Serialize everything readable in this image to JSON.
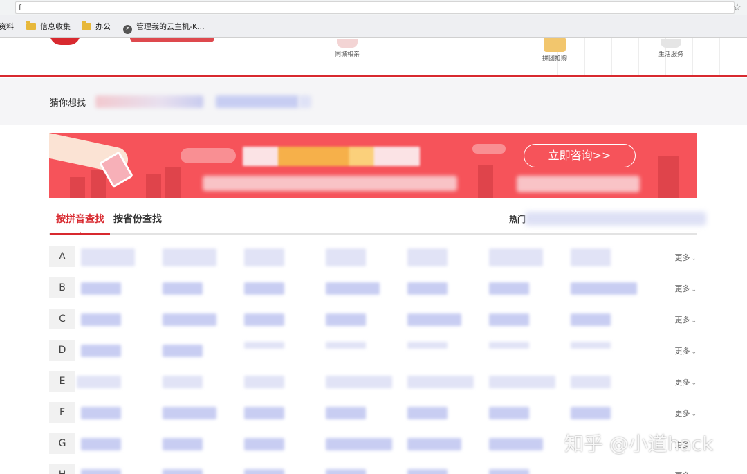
{
  "browser": {
    "address": "f",
    "bookmarks": [
      {
        "label": "资料",
        "icon": "none"
      },
      {
        "label": "信息收集",
        "icon": "folder-icon"
      },
      {
        "label": "办公",
        "icon": "folder-icon"
      },
      {
        "label": "管理我的云主机-K...",
        "icon": "globe-icon"
      }
    ]
  },
  "header": {
    "nav": [
      {
        "label": "同城相亲"
      },
      {
        "label": "拼团抢购"
      },
      {
        "label": "生活服务"
      }
    ]
  },
  "guess": {
    "label": "猜你想找"
  },
  "banner": {
    "consult_label": "立即咨询>>"
  },
  "tabs": [
    {
      "label": "按拼音查找",
      "active": true
    },
    {
      "label": "按省份查找",
      "active": false
    }
  ],
  "hot": {
    "label": "热门"
  },
  "rows": [
    {
      "letter": "A",
      "more": "更多"
    },
    {
      "letter": "B",
      "more": "更多"
    },
    {
      "letter": "C",
      "more": "更多"
    },
    {
      "letter": "D",
      "more": "更多"
    },
    {
      "letter": "E",
      "more": "更多"
    },
    {
      "letter": "F",
      "more": "更多"
    },
    {
      "letter": "G",
      "more": "更多"
    },
    {
      "letter": "H",
      "more": "更多"
    }
  ],
  "watermark": "知乎 @小道hack",
  "colors": {
    "brand_red": "#d8292f",
    "banner_red": "#f6535a"
  }
}
